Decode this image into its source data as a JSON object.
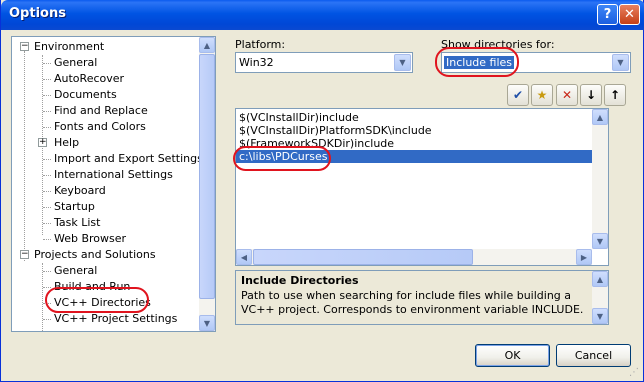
{
  "window": {
    "title": "Options",
    "help_label": "?",
    "close_label": "✕"
  },
  "tree": {
    "items": [
      {
        "label": "Environment",
        "expander": "−"
      },
      {
        "label": "General"
      },
      {
        "label": "AutoRecover"
      },
      {
        "label": "Documents"
      },
      {
        "label": "Find and Replace"
      },
      {
        "label": "Fonts and Colors"
      },
      {
        "label": "Help",
        "expander": "+"
      },
      {
        "label": "Import and Export Settings"
      },
      {
        "label": "International Settings"
      },
      {
        "label": "Keyboard"
      },
      {
        "label": "Startup"
      },
      {
        "label": "Task List"
      },
      {
        "label": "Web Browser"
      },
      {
        "label": "Projects and Solutions",
        "expander": "−"
      },
      {
        "label": "General"
      },
      {
        "label": "Build and Run"
      },
      {
        "label": "VC++ Directories"
      },
      {
        "label": "VC++ Project Settings"
      }
    ]
  },
  "platform": {
    "label": "Platform:",
    "value": "Win32"
  },
  "show_dirs": {
    "label": "Show directories for:",
    "value": "Include files"
  },
  "toolbar": {
    "check_icon": "✔",
    "new_folder_icon": "★",
    "delete_icon": "✕",
    "down_icon": "↓",
    "up_icon": "↑"
  },
  "directories": [
    "$(VCInstallDir)include",
    "$(VCInstallDir)PlatformSDK\\include",
    "$(FrameworkSDKDir)include",
    "c:\\libs\\PDCurses"
  ],
  "description": {
    "title": "Include Directories",
    "body": "Path to use when searching for include files while building a VC++ project. Corresponds to environment variable INCLUDE."
  },
  "buttons": {
    "ok": "OK",
    "cancel": "Cancel"
  },
  "colors": {
    "selection": "#316ac5",
    "highlight_oval": "#e0141e",
    "titlebar": "#0054e3"
  }
}
